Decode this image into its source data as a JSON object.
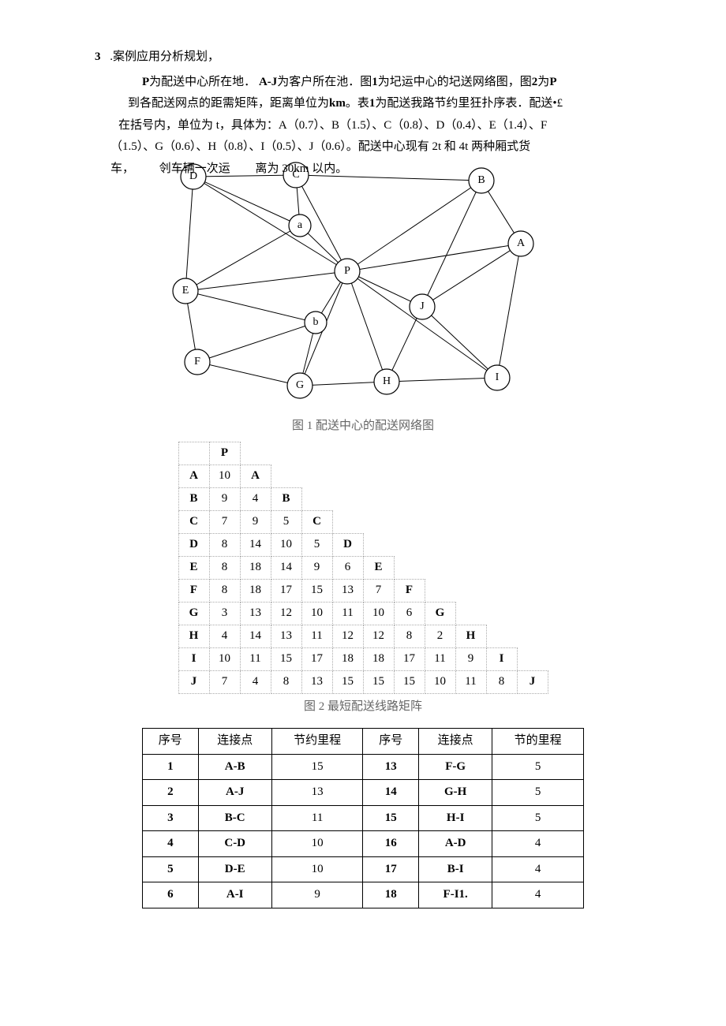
{
  "section_number": "3",
  "section_title": ".案例应用分析规划，",
  "p1_a": "P",
  "p1_b": "为配送中心所在地．",
  "p1_c": "A-J",
  "p1_d": "为客户所在池．图",
  "p1_e": "1",
  "p1_f": "为圮运中心的圮送网络图，图",
  "p1_g": "2",
  "p1_h": "为",
  "p1_i": "P",
  "p2_a": "到各配送网点的距需矩阵，距离单位为",
  "p2_b": "km",
  "p2_c": "。表",
  "p2_d": "1",
  "p2_e": "为配送我路节约里狂扑序表．配送•£",
  "p3": "在括号内，单位为 t，具体为：A（0.7）、B（1.5）、C（0.8）、D（0.4）、E（1.4）、F",
  "p4": "（1.5）、G（0.6）、H（0.8）、I（0.5）、J（0.6）。配送中心现有 2t 和 4t 两种厢式货",
  "p5a": "车，",
  "p5b": "刢车辆一次运",
  "p5c": "离为 30km 以内。",
  "caption1": "图 1 配送中心的配送网络图",
  "caption2": "图 2 最短配送线路矩阵",
  "nodes": {
    "P": "P",
    "A": "A",
    "B": "B",
    "C": "C",
    "D": "D",
    "E": "E",
    "F": "F",
    "G": "G",
    "H": "H",
    "I": "I",
    "J": "J",
    "a": "a",
    "b": "b"
  },
  "matrix_header": [
    "",
    "P",
    "A",
    "B",
    "C",
    "D",
    "E",
    "F",
    "G",
    "H",
    "I",
    "J"
  ],
  "matrix": [
    [
      "",
      "P"
    ],
    [
      "A",
      "10",
      "A"
    ],
    [
      "B",
      "9",
      "4",
      "B"
    ],
    [
      "C",
      "7",
      "9",
      "5",
      "C"
    ],
    [
      "D",
      "8",
      "14",
      "10",
      "5",
      "D"
    ],
    [
      "E",
      "8",
      "18",
      "14",
      "9",
      "6",
      "E"
    ],
    [
      "F",
      "8",
      "18",
      "17",
      "15",
      "13",
      "7",
      "F"
    ],
    [
      "G",
      "3",
      "13",
      "12",
      "10",
      "11",
      "10",
      "6",
      "G"
    ],
    [
      "H",
      "4",
      "14",
      "13",
      "11",
      "12",
      "12",
      "8",
      "2",
      "H"
    ],
    [
      "I",
      "10",
      "11",
      "15",
      "17",
      "18",
      "18",
      "17",
      "11",
      "9",
      "I"
    ],
    [
      "J",
      "7",
      "4",
      "8",
      "13",
      "15",
      "15",
      "15",
      "10",
      "11",
      "8",
      "J"
    ]
  ],
  "seq_headers": [
    "序号",
    "连接点",
    "节约里程",
    "序号",
    "连接点",
    "节的里程"
  ],
  "seq_rows": [
    [
      "1",
      "A-B",
      "15",
      "13",
      "F-G",
      "5"
    ],
    [
      "2",
      "A-J",
      "13",
      "14",
      "G-H",
      "5"
    ],
    [
      "3",
      "B-C",
      "11",
      "15",
      "H-I",
      "5"
    ],
    [
      "4",
      "C-D",
      "10",
      "16",
      "A-D",
      "4"
    ],
    [
      "5",
      "D-E",
      "10",
      "17",
      "B-I",
      "4"
    ],
    [
      "6",
      "A-I",
      "9",
      "18",
      "F-I1.",
      "4"
    ]
  ]
}
